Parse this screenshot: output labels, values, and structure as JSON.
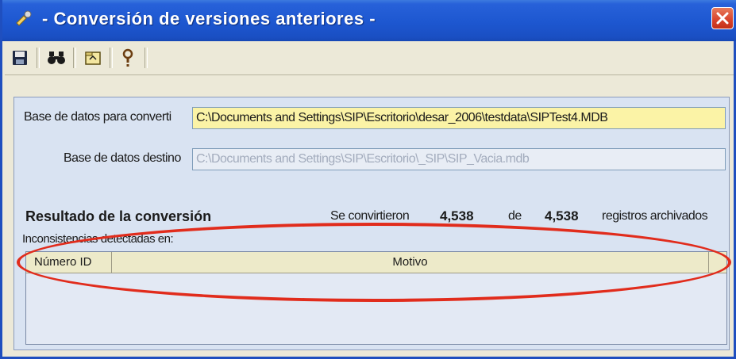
{
  "window": {
    "title": " - Conversión de versiones anteriores -",
    "app_icon": "tool-icon",
    "close_icon": "close-icon"
  },
  "toolbar": {
    "buttons": [
      {
        "icon": "save-icon"
      },
      {
        "icon": "binoculars-icon"
      },
      {
        "icon": "folder-icon"
      },
      {
        "icon": "help-icon"
      }
    ]
  },
  "form": {
    "source_label": "Base de datos para converti",
    "source_value": "C:\\Documents and Settings\\SIP\\Escritorio\\desar_2006\\testdata\\SIPTest4.MDB",
    "dest_label": "Base de datos destino",
    "dest_value": "C:\\Documents and Settings\\SIP\\Escritorio\\_SIP\\SIP_Vacia.mdb"
  },
  "result": {
    "title": "Resultado de la conversión",
    "converted_text": "Se convirtieron",
    "converted_count": "4,538",
    "of_text": "de",
    "total_count": "4,538",
    "suffix_text": "registros archivados",
    "inconsistencies_label": "Inconsistencias detectadas en:"
  },
  "table": {
    "columns": [
      "Número ID",
      "Motivo"
    ],
    "rows": []
  },
  "colors": {
    "titlebar": "#1d57d0",
    "panel": "#d9e3f2",
    "source_field": "#fbf3a6",
    "annotation": "#e12c1c"
  }
}
